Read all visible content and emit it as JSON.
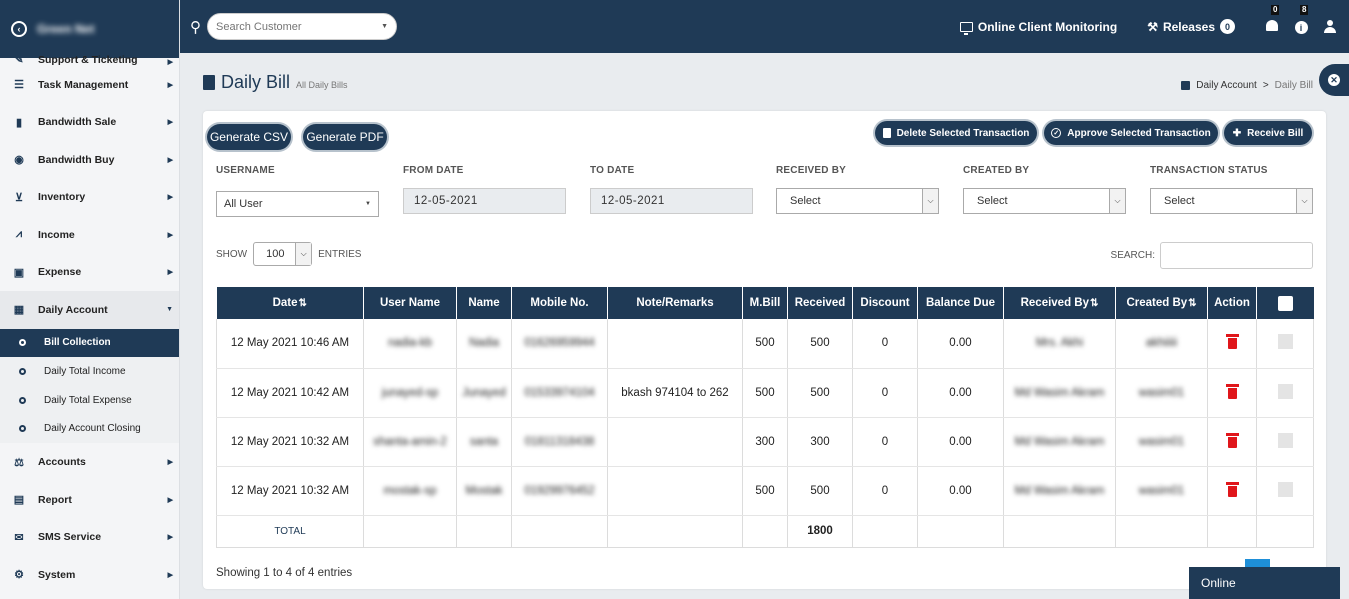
{
  "brand": {
    "name": "Green Net"
  },
  "sidebar": {
    "items": [
      {
        "label": "Support & Ticketing",
        "icon": "ticket-icon"
      },
      {
        "label": "Task Management",
        "icon": "list-icon"
      },
      {
        "label": "Bandwidth Sale",
        "icon": "bandwidth-sale-icon"
      },
      {
        "label": "Bandwidth Buy",
        "icon": "bandwidth-buy-icon"
      },
      {
        "label": "Inventory",
        "icon": "cart-icon"
      },
      {
        "label": "Income",
        "icon": "chart-icon"
      },
      {
        "label": "Expense",
        "icon": "money-icon"
      },
      {
        "label": "Daily Account",
        "icon": "calendar-check-icon"
      },
      {
        "label": "Accounts",
        "icon": "scale-icon"
      },
      {
        "label": "Report",
        "icon": "file-icon"
      },
      {
        "label": "SMS Service",
        "icon": "envelope-icon"
      },
      {
        "label": "System",
        "icon": "cogs-icon"
      }
    ],
    "sub_items": [
      "Bill Collection",
      "Daily Total Income",
      "Daily Total Expense",
      "Daily Account Closing"
    ]
  },
  "topbar": {
    "search_placeholder": "Search Customer",
    "monitoring_label": "Online Client Monitoring",
    "releases_label": "Releases",
    "releases_count": "0",
    "notifications_count": "0",
    "info_count": "8"
  },
  "page": {
    "title": "Daily Bill",
    "subtitle": "All Daily Bills",
    "breadcrumb_parent": "Daily Account",
    "breadcrumb_separator": ">",
    "breadcrumb_current": "Daily Bill"
  },
  "toolbar": {
    "csv_label": "Generate CSV",
    "pdf_label": "Generate PDF",
    "delete_label": "Delete Selected Transaction",
    "approve_label": "Approve Selected Transaction",
    "receive_label": "Receive Bill"
  },
  "filters": {
    "username_label": "USERNAME",
    "username_value": "All User",
    "from_label": "FROM DATE",
    "from_value": "12-05-2021",
    "to_label": "TO DATE",
    "to_value": "12-05-2021",
    "received_by_label": "RECEIVED BY",
    "received_by_value": "Select",
    "created_by_label": "CREATED BY",
    "created_by_value": "Select",
    "status_label": "TRANSACTION STATUS",
    "status_value": "Select"
  },
  "list_controls": {
    "show_label": "SHOW",
    "show_value": "100",
    "entries_label": "ENTRIES",
    "search_label": "SEARCH:"
  },
  "table": {
    "headers": [
      "Date",
      "User Name",
      "Name",
      "Mobile No.",
      "Note/Remarks",
      "M.Bill",
      "Received",
      "Discount",
      "Balance Due",
      "Received By",
      "Created By",
      "Action"
    ],
    "rows": [
      {
        "date": "12 May 2021 10:46 AM",
        "username": "nadia-kb",
        "name": "Nadia",
        "mobile": "01626959944",
        "note": "",
        "mbill": "500",
        "received": "500",
        "discount": "0",
        "due": "0.00",
        "received_by": "Mrs. Akhi",
        "created_by": "akhiiiii"
      },
      {
        "date": "12 May 2021 10:42 AM",
        "username": "junayed-sp",
        "name": "Junayed",
        "mobile": "01533974104",
        "note": "bkash 974104 to 262",
        "mbill": "500",
        "received": "500",
        "discount": "0",
        "due": "0.00",
        "received_by": "Md Wasim Akram",
        "created_by": "wasim01"
      },
      {
        "date": "12 May 2021 10:32 AM",
        "username": "shanta-amin-2",
        "name": "santa",
        "mobile": "01811318438",
        "note": "",
        "mbill": "300",
        "received": "300",
        "discount": "0",
        "due": "0.00",
        "received_by": "Md Wasim Akram",
        "created_by": "wasim01"
      },
      {
        "date": "12 May 2021 10:32 AM",
        "username": "mostak-sp",
        "name": "Mostak",
        "mobile": "01929976452",
        "note": "",
        "mbill": "500",
        "received": "500",
        "discount": "0",
        "due": "0.00",
        "received_by": "Md Wasim Akram",
        "created_by": "wasim01"
      }
    ],
    "total_label": "TOTAL",
    "total_received": "1800"
  },
  "footer": {
    "info": "Showing 1 to 4 of 4 entries",
    "online_label": "Online"
  },
  "colors": {
    "primary": "#1f3a56",
    "danger": "#e0161b",
    "page_active": "#1e8fd8"
  }
}
